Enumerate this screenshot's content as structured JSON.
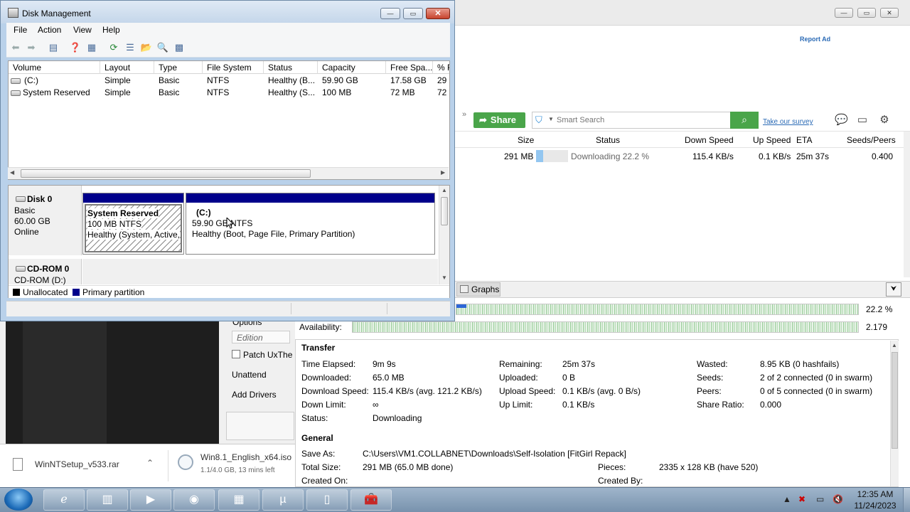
{
  "disk_mgmt": {
    "title": "Disk Management",
    "menu": [
      "File",
      "Action",
      "View",
      "Help"
    ],
    "columns": [
      "Volume",
      "Layout",
      "Type",
      "File System",
      "Status",
      "Capacity",
      "Free Spa...",
      "% F"
    ],
    "rows": [
      [
        "(C:)",
        "Simple",
        "Basic",
        "NTFS",
        "Healthy (B...",
        "59.90 GB",
        "17.58 GB",
        "29"
      ],
      [
        "System Reserved",
        "Simple",
        "Basic",
        "NTFS",
        "Healthy (S...",
        "100 MB",
        "72 MB",
        "72"
      ]
    ],
    "disk0": {
      "name": "Disk 0",
      "type": "Basic",
      "size": "60.00 GB",
      "state": "Online"
    },
    "partitions": {
      "sys": {
        "name": "System Reserved",
        "size": "100 MB NTFS",
        "status": "Healthy (System, Active,"
      },
      "c": {
        "name": "(C:)",
        "size": "59.90 GB NTFS",
        "status": "Healthy (Boot, Page File, Primary Partition)"
      }
    },
    "cdrom": {
      "name": "CD-ROM 0",
      "drive": "CD-ROM (D:)"
    },
    "legend": [
      "Unallocated",
      "Primary partition"
    ],
    "colors": {
      "primary": "#00008b",
      "unallocated": "#000000"
    }
  },
  "utorrent": {
    "report_ad": "Report Ad",
    "share_label": "Share",
    "search_placeholder": "Smart Search",
    "survey_link": "Take our survey",
    "columns": [
      "Size",
      "Status",
      "Down Speed",
      "Up Speed",
      "ETA",
      "Seeds/Peers"
    ],
    "torrent": {
      "size": "291 MB",
      "status": "Downloading 22.2 %",
      "progress": 0.222,
      "down_speed": "115.4 KB/s",
      "up_speed": "0.1 KB/s",
      "eta": "25m 37s",
      "seeds_peers": "0.400"
    },
    "tab_graphs": "Graphs",
    "downloaded_pct": "22.2 %",
    "availability_label": "Availability:",
    "availability_value": "2.179",
    "transfer": {
      "title": "Transfer",
      "col1": [
        [
          "Time Elapsed:",
          "9m 9s"
        ],
        [
          "Downloaded:",
          "65.0 MB"
        ],
        [
          "Download Speed:",
          "115.4 KB/s (avg. 121.2 KB/s)"
        ],
        [
          "Down Limit:",
          "∞"
        ],
        [
          "Status:",
          "Downloading"
        ]
      ],
      "col2": [
        [
          "Remaining:",
          "25m 37s"
        ],
        [
          "Uploaded:",
          "0 B"
        ],
        [
          "Upload Speed:",
          "0.1 KB/s (avg. 0 B/s)"
        ],
        [
          "Up Limit:",
          "0.1 KB/s"
        ]
      ],
      "col3": [
        [
          "Wasted:",
          "8.95 KB (0 hashfails)"
        ],
        [
          "Seeds:",
          "2 of 2 connected (0 in swarm)"
        ],
        [
          "Peers:",
          "0 of 5 connected (0 in swarm)"
        ],
        [
          "Share Ratio:",
          "0.000"
        ]
      ]
    },
    "general": {
      "title": "General",
      "save_as_label": "Save As:",
      "save_as": "C:\\Users\\VM1.COLLABNET\\Downloads\\Self-Isolation [FitGirl Repack]",
      "total_size_label": "Total Size:",
      "total_size": "291 MB (65.0 MB done)",
      "pieces_label": "Pieces:",
      "pieces": "2335 x 128 KB (have 520)",
      "created_on_label": "Created On:",
      "created_by_label": "Created By:"
    },
    "colors": {
      "accent": "#4aa54a",
      "link": "#2a6ab5",
      "progress": "#8ec3f0"
    }
  },
  "winntsetup": {
    "options": "Options",
    "edition": "Edition",
    "patch": "Patch UxThe",
    "unattend": "Unattend",
    "add_drivers": "Add Drivers"
  },
  "downloads": [
    {
      "name": "WinNTSetup_v533.rar",
      "meta": ""
    },
    {
      "name": "Win8.1_English_x64.iso",
      "meta": "1.1/4.0 GB, 13 mins left"
    }
  ],
  "taskbar": {
    "time": "12:35 AM",
    "date": "11/24/2023",
    "apps": [
      "ie-icon",
      "explorer-icon",
      "media-player-icon",
      "chrome-icon",
      "control-panel-icon",
      "utorrent-icon",
      "file-icon",
      "toolbox-icon"
    ]
  }
}
